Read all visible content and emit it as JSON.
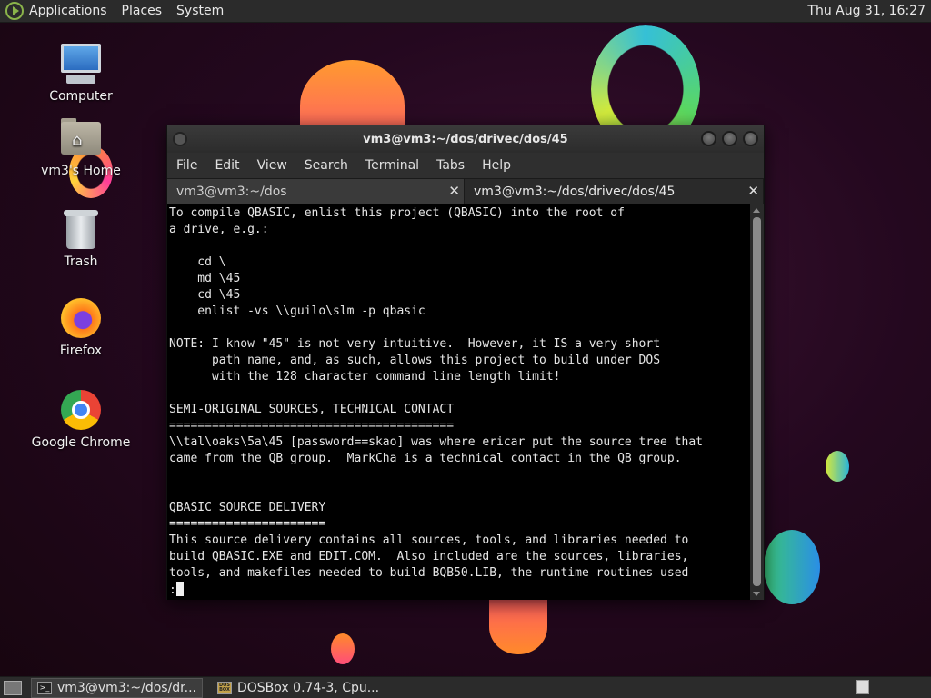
{
  "top_panel": {
    "menus": [
      "Applications",
      "Places",
      "System"
    ],
    "clock": "Thu Aug 31, 16:27"
  },
  "desktop_icons": [
    {
      "label": "Computer",
      "icon": "computer-icon"
    },
    {
      "label": "vm3's Home",
      "icon": "home-folder-icon"
    },
    {
      "label": "Trash",
      "icon": "trash-icon"
    },
    {
      "label": "Firefox",
      "icon": "firefox-icon"
    },
    {
      "label": "Google Chrome",
      "icon": "chrome-icon"
    }
  ],
  "window": {
    "title": "vm3@vm3:~/dos/drivec/dos/45",
    "menu": [
      "File",
      "Edit",
      "View",
      "Search",
      "Terminal",
      "Tabs",
      "Help"
    ],
    "tabs": [
      {
        "label": "vm3@vm3:~/dos",
        "active": false
      },
      {
        "label": "vm3@vm3:~/dos/drivec/dos/45",
        "active": true
      }
    ],
    "tab_close_glyph": "✕",
    "terminal_lines": [
      "To compile QBASIC, enlist this project (QBASIC) into the root of",
      "a drive, e.g.:",
      "",
      "    cd \\",
      "    md \\45",
      "    cd \\45",
      "    enlist -vs \\\\guilo\\slm -p qbasic",
      "",
      "NOTE: I know \"45\" is not very intuitive.  However, it IS a very short",
      "      path name, and, as such, allows this project to build under DOS",
      "      with the 128 character command line length limit!",
      "",
      "SEMI-ORIGINAL SOURCES, TECHNICAL CONTACT",
      "========================================",
      "\\\\tal\\oaks\\5a\\45 [password==skao] was where ericar put the source tree that",
      "came from the QB group.  MarkCha is a technical contact in the QB group.",
      "",
      "",
      "QBASIC SOURCE DELIVERY",
      "======================",
      "This source delivery contains all sources, tools, and libraries needed to",
      "build QBASIC.EXE and EDIT.COM.  Also included are the sources, libraries,",
      "tools, and makefiles needed to build BQB50.LIB, the runtime routines used"
    ],
    "prompt": ":"
  },
  "taskbar": {
    "tasks": [
      {
        "label": "vm3@vm3:~/dos/dr...",
        "icon": "terminal-icon",
        "active": true
      },
      {
        "label": "DOSBox 0.74-3, Cpu...",
        "icon": "dosbox-icon",
        "active": false
      }
    ],
    "dosbox_icon_text": "DOS BOX"
  }
}
